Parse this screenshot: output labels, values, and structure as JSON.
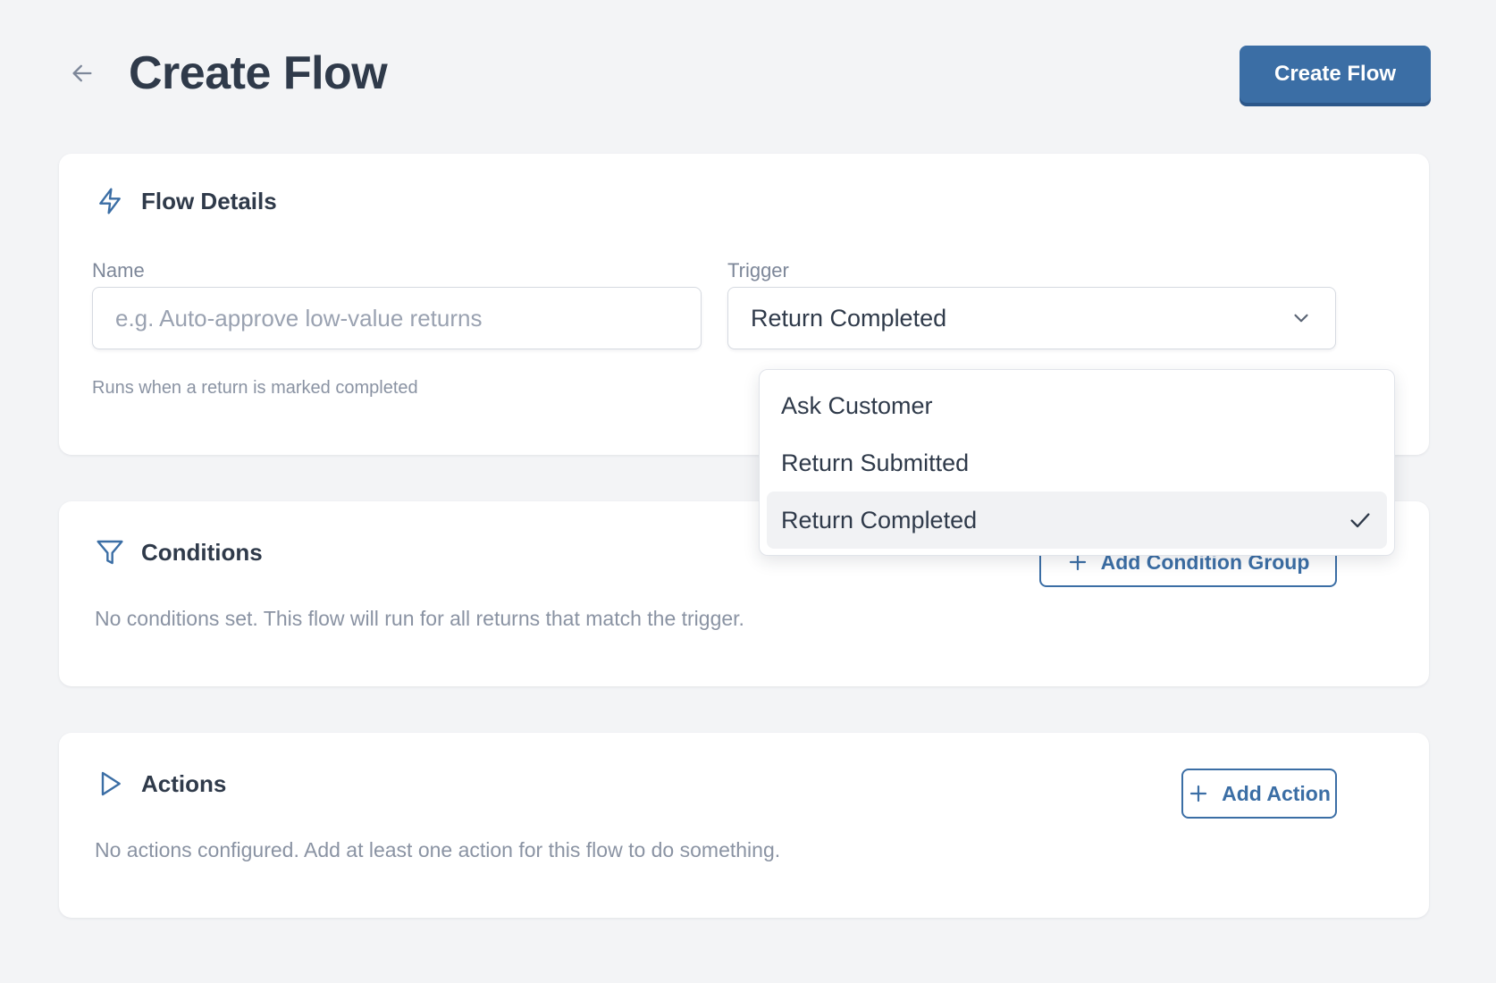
{
  "header": {
    "title": "Create Flow",
    "primary_button_label": "Create Flow"
  },
  "flow_details": {
    "title": "Flow Details",
    "name_label": "Name",
    "name_placeholder": "e.g. Auto-approve low-value returns",
    "name_value": "",
    "trigger_label": "Trigger",
    "trigger_value": "Return Completed",
    "trigger_helper": "Runs when a return is marked completed"
  },
  "trigger_dropdown": {
    "options": [
      {
        "label": "Ask Customer",
        "selected": false
      },
      {
        "label": "Return Submitted",
        "selected": false
      },
      {
        "label": "Return Completed",
        "selected": true
      }
    ]
  },
  "conditions": {
    "title": "Conditions",
    "add_button_label": "Add Condition Group",
    "empty_text": "No conditions set. This flow will run for all returns that match the trigger."
  },
  "actions": {
    "title": "Actions",
    "add_button_label": "Add Action",
    "empty_text": "No actions configured. Add at least one action for this flow to do something."
  },
  "colors": {
    "accent": "#3b6ea5",
    "background": "#f3f4f6",
    "text": "#2f3a4a",
    "muted": "#8a93a3"
  },
  "icons": {
    "back": "arrow-left-icon",
    "flow_details": "lightning-icon",
    "conditions": "filter-icon",
    "actions": "play-icon",
    "add": "plus-icon",
    "select": "chevron-down-icon",
    "selected": "check-icon"
  }
}
